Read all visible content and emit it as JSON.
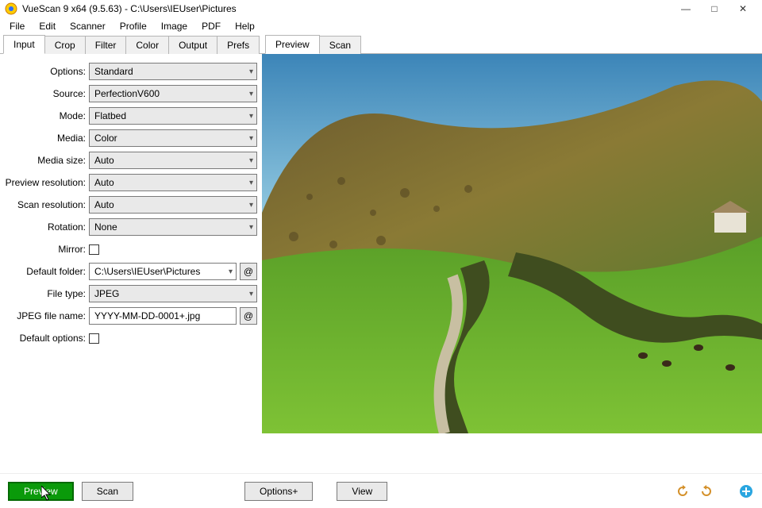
{
  "window": {
    "title": "VueScan 9 x64 (9.5.63) - C:\\Users\\IEUser\\Pictures",
    "min": "—",
    "max": "□",
    "close": "✕"
  },
  "menu": [
    "File",
    "Edit",
    "Scanner",
    "Profile",
    "Image",
    "PDF",
    "Help"
  ],
  "left_tabs": [
    "Input",
    "Crop",
    "Filter",
    "Color",
    "Output",
    "Prefs"
  ],
  "left_active_tab": 0,
  "right_tabs": [
    "Preview",
    "Scan"
  ],
  "right_active_tab": 0,
  "form": {
    "options_label": "Options:",
    "options_value": "Standard",
    "source_label": "Source:",
    "source_value": "PerfectionV600",
    "mode_label": "Mode:",
    "mode_value": "Flatbed",
    "media_label": "Media:",
    "media_value": "Color",
    "media_size_label": "Media size:",
    "media_size_value": "Auto",
    "preview_res_label": "Preview resolution:",
    "preview_res_value": "Auto",
    "scan_res_label": "Scan resolution:",
    "scan_res_value": "Auto",
    "rotation_label": "Rotation:",
    "rotation_value": "None",
    "mirror_label": "Mirror:",
    "default_folder_label": "Default folder:",
    "default_folder_value": "C:\\Users\\IEUser\\Pictures",
    "file_type_label": "File type:",
    "file_type_value": "JPEG",
    "jpeg_name_label": "JPEG file name:",
    "jpeg_name_value": "YYYY-MM-DD-0001+.jpg",
    "default_options_label": "Default options:",
    "at_symbol": "@"
  },
  "footer": {
    "preview": "Preview",
    "scan": "Scan",
    "options_plus": "Options+",
    "view": "View"
  }
}
